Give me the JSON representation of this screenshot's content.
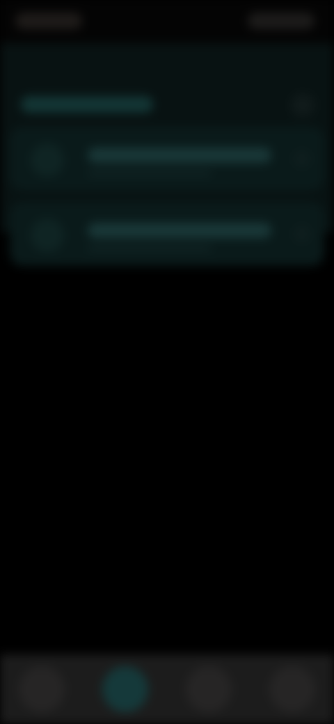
{
  "screen": {
    "state": "blurred",
    "background_color": "#000000"
  },
  "status_bar": {
    "left_placeholder": "",
    "right_placeholder": ""
  },
  "panel": {
    "title": "",
    "accent_color": "#193737",
    "items": [
      {
        "title": "",
        "subtitle": ""
      },
      {
        "title": "",
        "subtitle": ""
      }
    ]
  },
  "bottom_nav": {
    "active_index": 1,
    "items": [
      {
        "icon": "home-icon",
        "label": ""
      },
      {
        "icon": "explore-icon",
        "label": ""
      },
      {
        "icon": "library-icon",
        "label": ""
      },
      {
        "icon": "profile-icon",
        "label": ""
      }
    ]
  }
}
